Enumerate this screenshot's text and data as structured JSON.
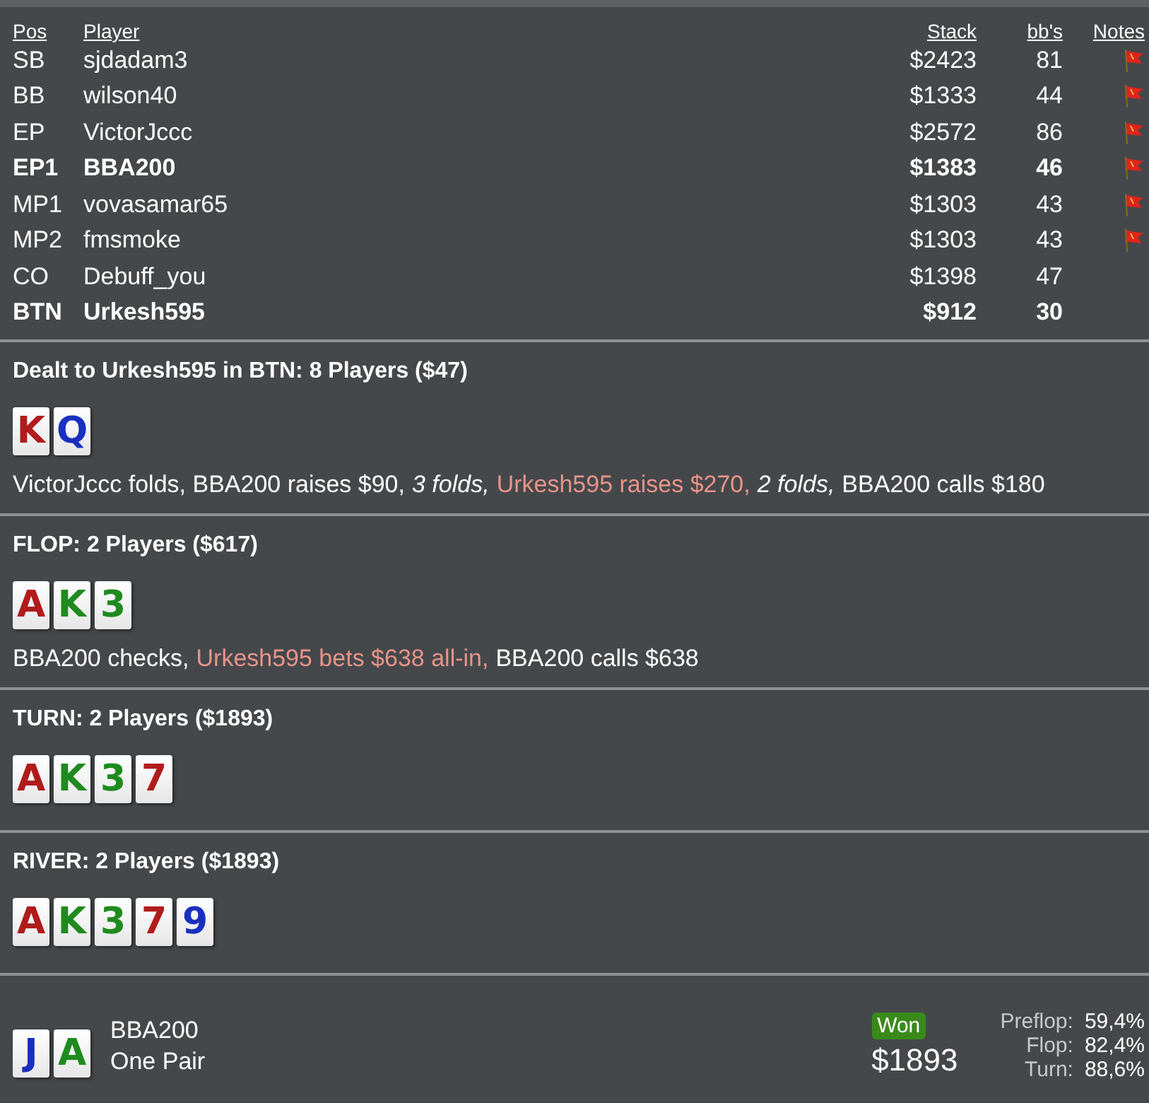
{
  "table": {
    "columns": [
      "Pos",
      "Player",
      "Stack",
      "bb's",
      "Notes"
    ],
    "rows": [
      {
        "pos": "SB",
        "player": "sjdadam3",
        "stack": "$2423",
        "bbs": "81",
        "highlighted": false,
        "note": true
      },
      {
        "pos": "BB",
        "player": "wilson40",
        "stack": "$1333",
        "bbs": "44",
        "highlighted": false,
        "note": true
      },
      {
        "pos": "EP",
        "player": "VictorJccc",
        "stack": "$2572",
        "bbs": "86",
        "highlighted": false,
        "note": true
      },
      {
        "pos": "EP1",
        "player": "BBA200",
        "stack": "$1383",
        "bbs": "46",
        "highlighted": true,
        "note": true
      },
      {
        "pos": "MP1",
        "player": "vovasamar65",
        "stack": "$1303",
        "bbs": "43",
        "highlighted": false,
        "note": true
      },
      {
        "pos": "MP2",
        "player": "fmsmoke",
        "stack": "$1303",
        "bbs": "43",
        "highlighted": false,
        "note": true
      },
      {
        "pos": "CO",
        "player": "Debuff_you",
        "stack": "$1398",
        "bbs": "47",
        "highlighted": false,
        "note": false
      },
      {
        "pos": "BTN",
        "player": "Urkesh595",
        "stack": "$912",
        "bbs": "30",
        "highlighted": true,
        "note": false
      }
    ]
  },
  "streets": [
    {
      "title": "Dealt to Urkesh595 in BTN: 8 Players ($47)",
      "cards": [
        {
          "rank": "K",
          "color": "#b01c1c"
        },
        {
          "rank": "Q",
          "color": "#1a2fc0"
        }
      ],
      "actions": [
        {
          "kind": "plain",
          "text": "VictorJccc folds, BBA200 raises $90,"
        },
        {
          "kind": "italic",
          "text": "3 folds,"
        },
        {
          "kind": "hero",
          "text": "Urkesh595 raises $270,"
        },
        {
          "kind": "italic",
          "text": "2 folds,"
        },
        {
          "kind": "plain",
          "text": "BBA200 calls $180"
        }
      ]
    },
    {
      "title": "FLOP: 2 Players ($617)",
      "cards": [
        {
          "rank": "A",
          "color": "#b01c1c"
        },
        {
          "rank": "K",
          "color": "#1f8a1f"
        },
        {
          "rank": "3",
          "color": "#1f8a1f"
        }
      ],
      "actions": [
        {
          "kind": "plain",
          "text": "BBA200 checks,"
        },
        {
          "kind": "hero",
          "text": "Urkesh595 bets $638 all-in,"
        },
        {
          "kind": "plain",
          "text": "BBA200 calls $638"
        }
      ]
    },
    {
      "title": "TURN: 2 Players ($1893)",
      "cards": [
        {
          "rank": "A",
          "color": "#b01c1c"
        },
        {
          "rank": "K",
          "color": "#1f8a1f"
        },
        {
          "rank": "3",
          "color": "#1f8a1f"
        },
        {
          "rank": "7",
          "color": "#b01c1c"
        }
      ]
    },
    {
      "title": "RIVER: 2 Players ($1893)",
      "cards": [
        {
          "rank": "A",
          "color": "#b01c1c"
        },
        {
          "rank": "K",
          "color": "#1f8a1f"
        },
        {
          "rank": "3",
          "color": "#1f8a1f"
        },
        {
          "rank": "7",
          "color": "#b01c1c"
        },
        {
          "rank": "9",
          "color": "#1a2fc0"
        }
      ]
    }
  ],
  "result": {
    "cards": [
      {
        "rank": "J",
        "color": "#1a2fc0"
      },
      {
        "rank": "A",
        "color": "#1f8a1f"
      }
    ],
    "player": "BBA200",
    "hand": "One Pair",
    "badge": "Won",
    "amount": "$1893",
    "equity": [
      {
        "label": "Preflop:",
        "value": "59,4%"
      },
      {
        "label": "Flop:",
        "value": "82,4%"
      },
      {
        "label": "Turn:",
        "value": "88,6%"
      }
    ]
  }
}
